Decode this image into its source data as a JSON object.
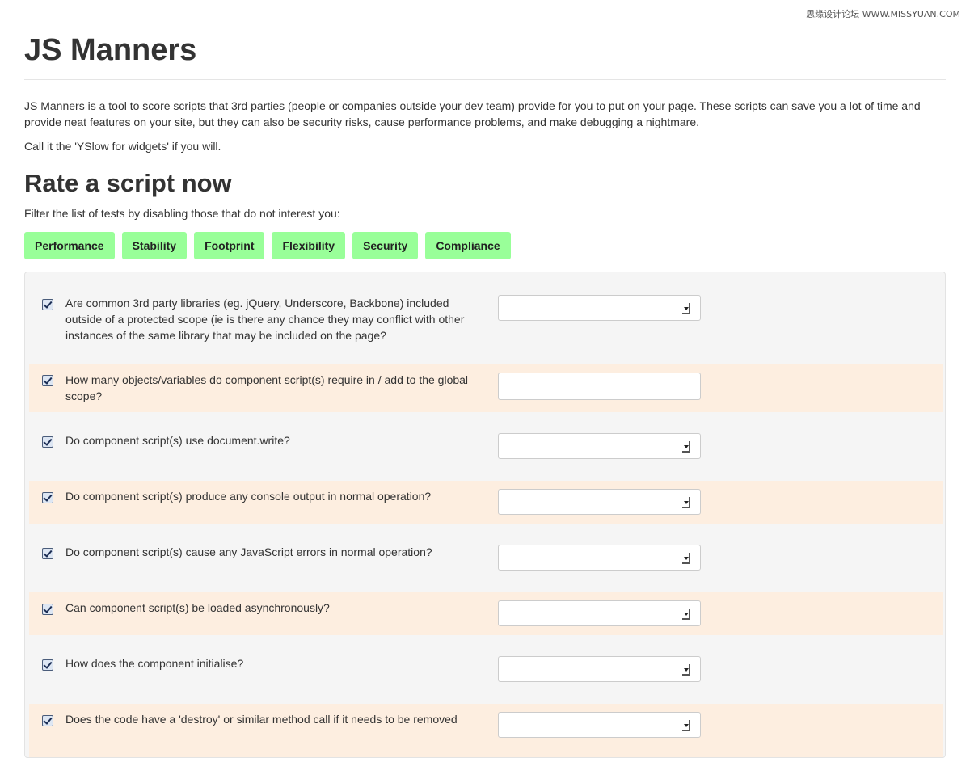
{
  "watermark": "思缘设计论坛 WWW.MISSYUAN.COM",
  "page": {
    "title": "JS Manners",
    "intro": "JS Manners is a tool to score scripts that 3rd parties (people or companies outside your dev team) provide for you to put on your page. These scripts can save you a lot of time and provide neat features on your site, but they can also be security risks, cause performance problems, and make debugging a nightmare.",
    "intro2": "Call it the 'YSlow for widgets' if you will."
  },
  "rate": {
    "heading": "Rate a script now",
    "filter_label": "Filter the list of tests by disabling those that do not interest you:",
    "filters": [
      "Performance",
      "Stability",
      "Footprint",
      "Flexibility",
      "Security",
      "Compliance"
    ]
  },
  "questions": [
    {
      "text": "Are common 3rd party libraries (eg. jQuery, Underscore, Backbone) included outside of a protected scope (ie is there any chance they may conflict with other instances of the same library that may be included on the page?",
      "checked": true,
      "control": "select"
    },
    {
      "text": "How many objects/variables do component script(s) require in / add to the global scope?",
      "checked": true,
      "control": "text"
    },
    {
      "text": "Do component script(s) use document.write?",
      "checked": true,
      "control": "select"
    },
    {
      "text": "Do component script(s) produce any console output in normal operation?",
      "checked": true,
      "control": "select"
    },
    {
      "text": "Do component script(s) cause any JavaScript errors in normal operation?",
      "checked": true,
      "control": "select"
    },
    {
      "text": "Can component script(s) be loaded asynchronously?",
      "checked": true,
      "control": "select"
    },
    {
      "text": "How does the component initialise?",
      "checked": true,
      "control": "select"
    },
    {
      "text": "Does the code have a 'destroy' or similar method call if it needs to be removed",
      "checked": true,
      "control": "select"
    }
  ],
  "colors": {
    "filter_bg": "#99ff99",
    "panel_bg": "#f5f5f5",
    "row_alt_bg": "#fdeee0"
  }
}
